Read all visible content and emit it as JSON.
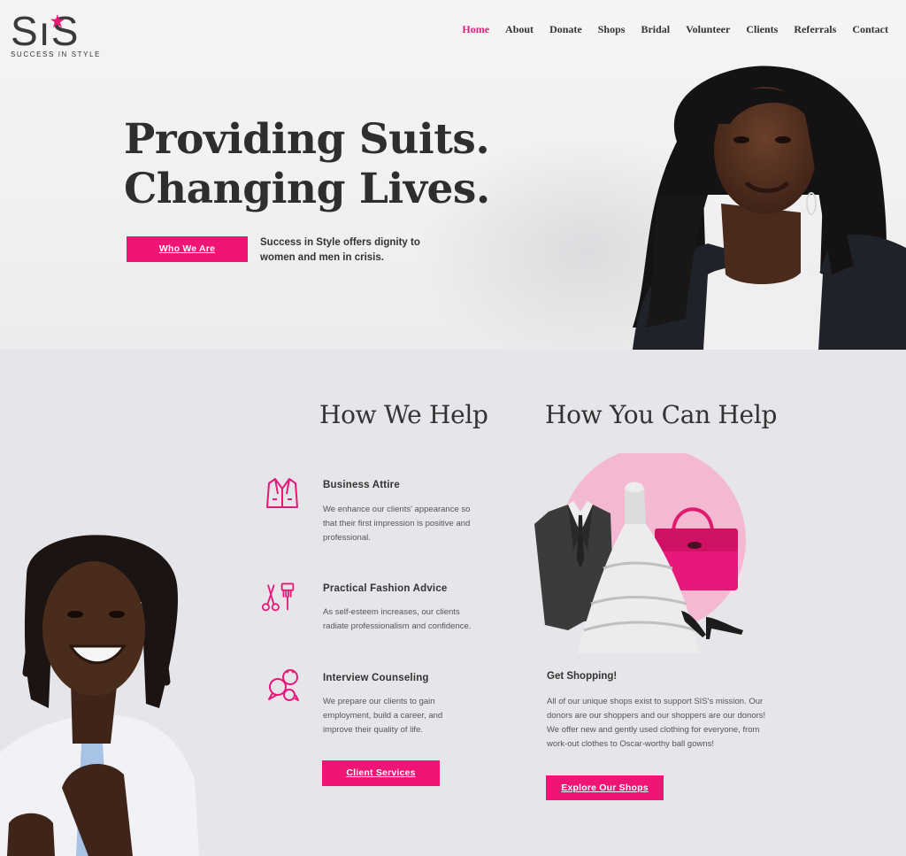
{
  "brand": {
    "logo_text": "SiS",
    "tagline": "SUCCESS IN STYLE"
  },
  "nav": {
    "items": [
      "Home",
      "About",
      "Donate",
      "Shops",
      "Bridal",
      "Volunteer",
      "Clients",
      "Referrals",
      "Contact"
    ],
    "active": "Home"
  },
  "hero": {
    "title_line1": "Providing Suits.",
    "title_line2": "Changing Lives.",
    "button_label": "Who We Are",
    "subtitle": "Success in Style offers dignity to women and men in crisis."
  },
  "how_we_help": {
    "heading": "How We Help",
    "services": [
      {
        "icon": "suit-jacket-icon",
        "title": "Business Attire",
        "text": "We enhance our clients' appearance so that their first impression is positive and professional."
      },
      {
        "icon": "scissors-comb-icon",
        "title": "Practical Fashion Advice",
        "text": "As self-esteem increases, our clients radiate professionalism and confidence."
      },
      {
        "icon": "speech-bubbles-icon",
        "title": "Interview Counseling",
        "text": "We prepare our clients to gain employment, build a career, and improve their quality of life."
      }
    ],
    "button_label": "Client Services"
  },
  "how_you_can_help": {
    "heading": "How You Can Help",
    "subheading": "Get Shopping!",
    "text": "All of our unique shops exist to support SIS's mission. Our donors are our shoppers and our shoppers are our donors! We offer new and gently used clothing for everyone, from work-out clothes to Oscar-worthy ball gowns!",
    "button_label": "Explore Our Shops"
  },
  "colors": {
    "accent": "#ee1574",
    "text": "#333333",
    "hero_bg": "#f2f2f3",
    "section_bg": "#e6e6ea"
  }
}
